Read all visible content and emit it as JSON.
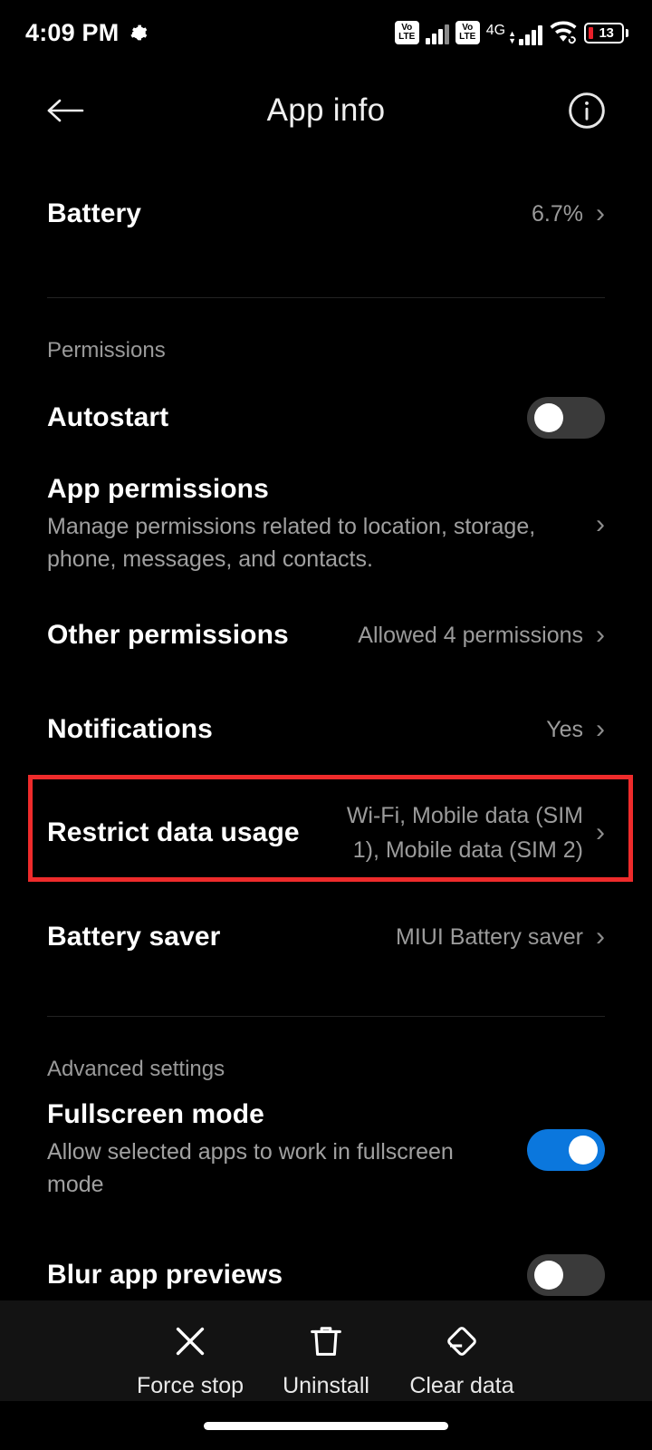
{
  "statusbar": {
    "time": "4:09 PM",
    "gear_icon": "gear-icon",
    "volte_top": "Vo",
    "volte_bottom": "LTE",
    "network_label": "4G",
    "wifi_icon": "wifi-icon",
    "battery_level": "13"
  },
  "appbar": {
    "back_icon": "back-arrow-icon",
    "title": "App info",
    "info_icon": "info-circle-icon"
  },
  "rows": {
    "battery": {
      "title": "Battery",
      "value": "6.7%"
    },
    "permissions_label": "Permissions",
    "autostart": {
      "title": "Autostart",
      "toggle": "off"
    },
    "app_permissions": {
      "title": "App permissions",
      "subtitle": "Manage permissions related to location, storage, phone, messages, and contacts."
    },
    "other_permissions": {
      "title": "Other permissions",
      "value": "Allowed 4 permissions"
    },
    "notifications": {
      "title": "Notifications",
      "value": "Yes"
    },
    "restrict_data_usage": {
      "title": "Restrict data usage",
      "value": "Wi-Fi, Mobile data (SIM 1), Mobile data (SIM 2)"
    },
    "battery_saver": {
      "title": "Battery saver",
      "value": "MIUI Battery saver"
    },
    "advanced_label": "Advanced settings",
    "fullscreen_mode": {
      "title": "Fullscreen mode",
      "subtitle": "Allow selected apps to work in fullscreen mode",
      "toggle": "on"
    },
    "blur_app_previews": {
      "title": "Blur app previews",
      "toggle": "off"
    }
  },
  "bottombar": {
    "force_stop": {
      "label": "Force stop",
      "icon": "close-x-icon"
    },
    "uninstall": {
      "label": "Uninstall",
      "icon": "trash-icon"
    },
    "clear_data": {
      "label": "Clear data",
      "icon": "eraser-icon"
    }
  },
  "colors": {
    "accent_blue": "#0b77dd",
    "highlight_red": "#ee2b2b",
    "background": "#000000",
    "bottombar_bg": "#131313"
  }
}
